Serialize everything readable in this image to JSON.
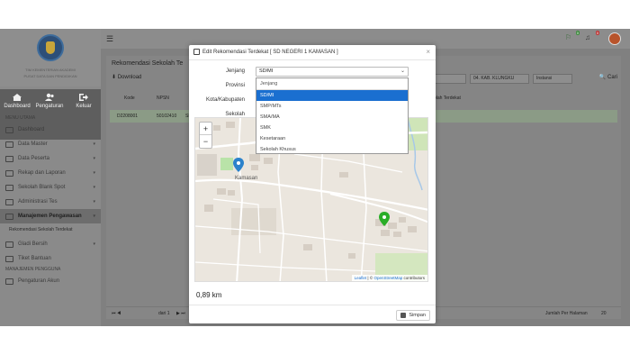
{
  "sidebar": {
    "brand_line1": "TIM KEMENTERIAN AKADEMI",
    "brand_line2": "PUSAT DATA DAN PENDIDIKAN",
    "quick": [
      {
        "label": "Dashboard",
        "icon": "home-icon"
      },
      {
        "label": "Pengaturan",
        "icon": "users-icon"
      },
      {
        "label": "Keluar",
        "icon": "logout-icon"
      }
    ],
    "section_main": "MENU UTAMA",
    "items": [
      {
        "label": "Dashboard",
        "arrow": ""
      },
      {
        "label": "Data Master",
        "arrow": "▾"
      },
      {
        "label": "Data Peserta",
        "arrow": "▾"
      },
      {
        "label": "Rekap dan Laporan",
        "arrow": "▾"
      },
      {
        "label": "Sekolah Blank Spot",
        "arrow": "▾"
      },
      {
        "label": "Administrasi Tes",
        "arrow": "▾"
      },
      {
        "label": "Manajemen Pengawasan",
        "arrow": "▾"
      }
    ],
    "sub_item": "Rekomendasi Sekolah Terdekat",
    "items2": [
      {
        "label": "Gladi Bersih",
        "arrow": "▾"
      },
      {
        "label": "Tiket Bantuan",
        "arrow": ""
      }
    ],
    "section_account": "MANAJEMEN PENGGUNA",
    "account_item": "Pengaturan Akun"
  },
  "topbar": {
    "badge1": "0",
    "badge2": "0"
  },
  "panel": {
    "title": "Rekomendasi Sekolah Te",
    "download": "Download",
    "filter1": "",
    "filter2": "04. KAB. KLUNGKU",
    "filter3": "Instansi",
    "search": "Cari",
    "headers": [
      "Kode",
      "NPSN"
    ],
    "header_right": "olah Terdekat",
    "row": [
      "D2208001",
      "50102410",
      "SD N"
    ],
    "pager_page": "dari 1",
    "pager_right": "Jumlah Per Halaman",
    "per_page": "20"
  },
  "modal": {
    "title_prefix": "Edit Rekomendasi Terdekat",
    "title_school": "[ SD NEGERI 1 KAMASAN ]",
    "labels": {
      "jenjang": "Jenjang",
      "provinsi": "Provinsi",
      "kota": "Kota/Kabupaten",
      "sekolah": "Sekolah"
    },
    "select_value": "SD/MI",
    "options": [
      "Jenjang",
      "SD/MI",
      "SMP/MTs",
      "SMA/MA",
      "SMK",
      "Kesetaraan",
      "Sekolah Khusus"
    ],
    "selected_index": 1,
    "map": {
      "place_label": "Kamasan",
      "zoom_in": "+",
      "zoom_out": "−",
      "attribution_leaflet": "Leaflet",
      "attribution_sep": "| ©",
      "attribution_osm": "OpenStreetMap",
      "attribution_tail": "contributors",
      "marker_blue": "#2b82cb",
      "marker_green": "#2aad27"
    },
    "distance": "0,89 km",
    "save_label": "Simpan"
  }
}
